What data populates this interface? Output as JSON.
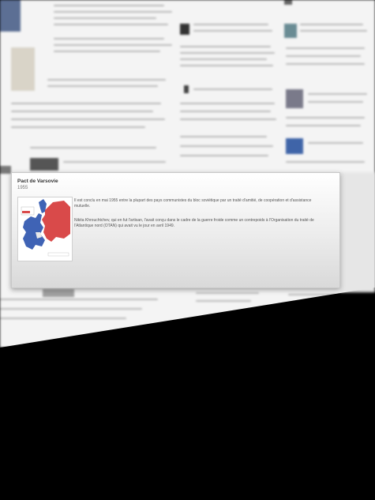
{
  "card": {
    "title": "Pact de Varsovie",
    "year": "1955",
    "paragraphs": [
      "Il est conclu en mai 1955 entre la plupart des pays communistes du bloc soviétique par un traité d'amitié, de coopération et d'assistance mutuelle.",
      "Nikita Khrouchtchev, qui en fut l'artisan, l'avait conçu dans le cadre de la guerre froide comme un contrepoids à l'Organisation du traité de l'Atlantique nord (OTAN) qui avait vu le jour en avril 1949."
    ],
    "map": {
      "east_color": "#d94a4a",
      "west_color": "#3f63b5",
      "neutral_color": "#e9e9e9"
    }
  },
  "colors": {
    "wall": "#f4f4f4",
    "void": "#000000"
  }
}
